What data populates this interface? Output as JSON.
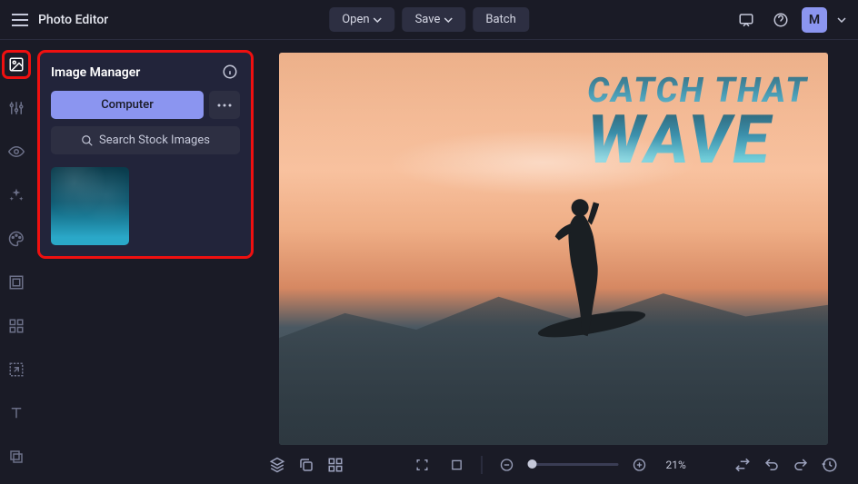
{
  "app_title": "Photo Editor",
  "topbar": {
    "open_label": "Open",
    "save_label": "Save",
    "batch_label": "Batch",
    "avatar_letter": "M"
  },
  "rail_icons": [
    {
      "name": "image-manager-icon",
      "active": true
    },
    {
      "name": "adjustments-icon",
      "active": false
    },
    {
      "name": "eye-icon",
      "active": false
    },
    {
      "name": "sparkle-icon",
      "active": false
    },
    {
      "name": "palette-icon",
      "active": false
    },
    {
      "name": "frame-icon",
      "active": false
    },
    {
      "name": "elements-icon",
      "active": false
    },
    {
      "name": "resize-icon",
      "active": false
    },
    {
      "name": "text-icon",
      "active": false
    },
    {
      "name": "mask-icon",
      "active": false
    }
  ],
  "panel": {
    "title": "Image Manager",
    "computer_btn": "Computer",
    "search_stock_btn": "Search Stock Images"
  },
  "canvas_text": {
    "line1": "CATCH THAT",
    "line2": "WAVE"
  },
  "bottombar": {
    "zoom_value": "21%"
  }
}
